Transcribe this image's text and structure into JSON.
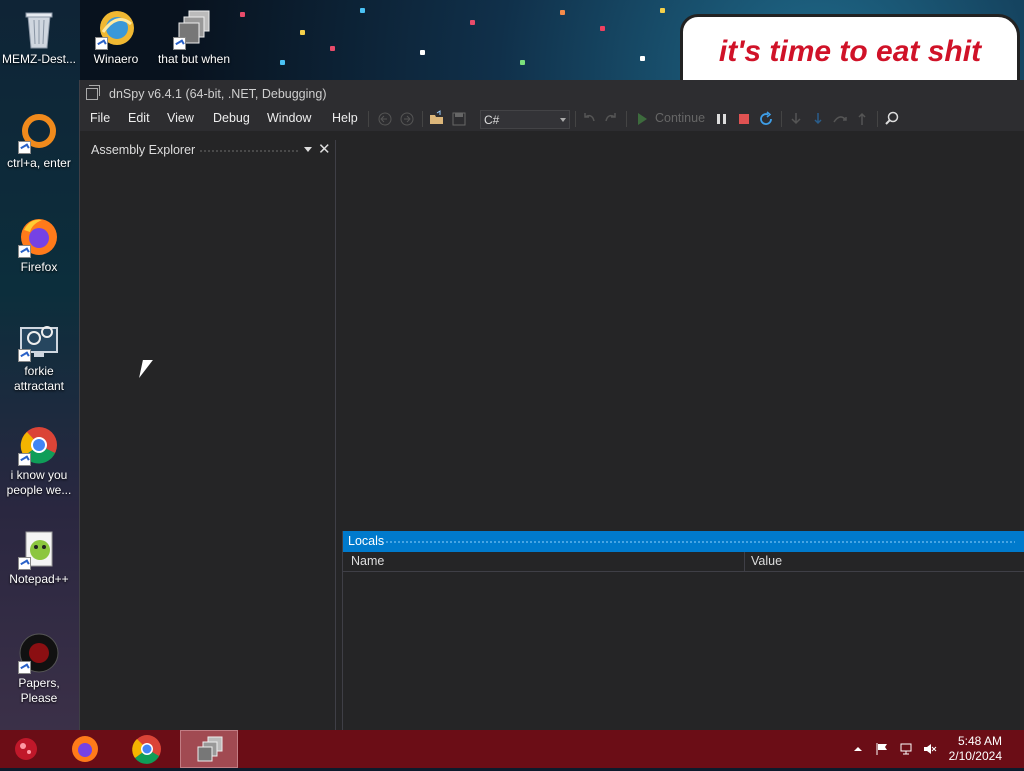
{
  "desktop": {
    "banner_text": "it's time to eat shit",
    "icons": [
      {
        "label": "MEMZ-Dest...",
        "icon": "recycle-bin-icon"
      },
      {
        "label": "Winaero",
        "icon": "winaero-icon"
      },
      {
        "label": "that but when",
        "icon": "app-stack-icon"
      },
      {
        "label": "ctrl+a, enter",
        "icon": "orange-ring-icon"
      },
      {
        "label": "Firefox",
        "icon": "firefox-icon"
      },
      {
        "label": "forkie attractant",
        "icon": "gear-monitor-icon"
      },
      {
        "label": "i know you people we...",
        "icon": "chrome-icon"
      },
      {
        "label": "Notepad++",
        "icon": "notepadpp-icon"
      },
      {
        "label": "Papers, Please",
        "icon": "papers-please-icon"
      }
    ]
  },
  "window": {
    "title": "dnSpy v6.4.1 (64-bit, .NET, Debugging)",
    "menu": [
      "File",
      "Edit",
      "View",
      "Debug",
      "Window",
      "Help"
    ],
    "toolbar": {
      "language": "C#",
      "continue_label": "Continue"
    },
    "assembly_explorer": {
      "title": "Assembly Explorer"
    },
    "locals": {
      "title": "Locals",
      "columns": [
        "Name",
        "Value"
      ]
    }
  },
  "taskbar": {
    "time": "5:48 AM",
    "date": "2/10/2024"
  },
  "colors": {
    "accent": "#007acc",
    "taskbar": "#6b0d16",
    "window_bg": "#252526"
  }
}
